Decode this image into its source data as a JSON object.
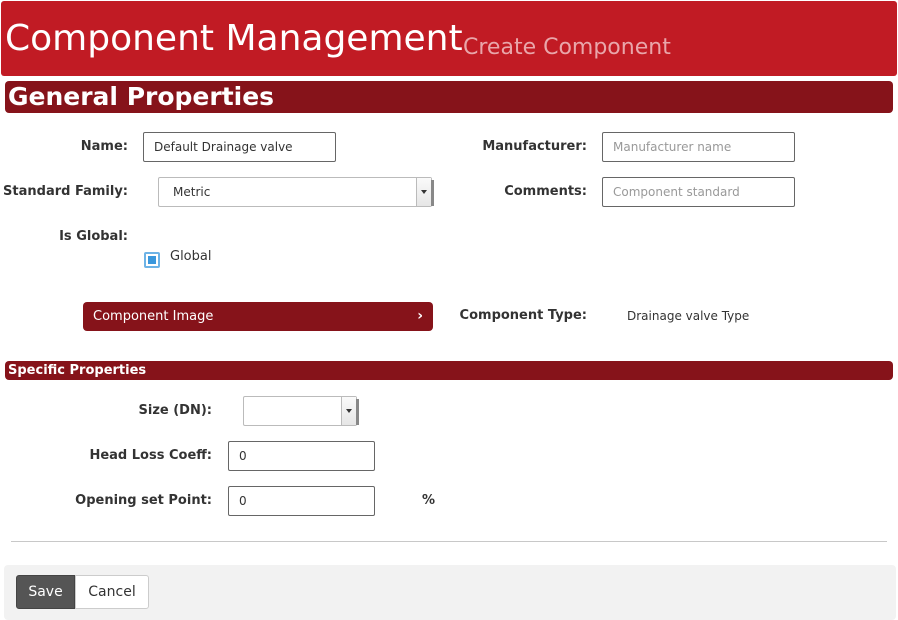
{
  "header": {
    "title": "Component Management",
    "subtitle": "Create Component"
  },
  "general": {
    "section_title": "General Properties",
    "name_label": "Name:",
    "name_value": "Default Drainage valve",
    "manufacturer_label": "Manufacturer:",
    "manufacturer_placeholder": "Manufacturer name",
    "standard_family_label": "Standard Family:",
    "standard_family_value": "Metric",
    "comments_label": "Comments:",
    "comments_placeholder": "Component standard",
    "is_global_label": "Is Global:",
    "global_checkbox_label": "Global",
    "global_checked": true,
    "component_image_button": "Component Image",
    "component_type_label": "Component Type:",
    "component_type_value": "Drainage valve Type"
  },
  "specific": {
    "section_title": "Specific Properties",
    "size_label": "Size (DN):",
    "size_value": "",
    "head_loss_label": "Head Loss Coeff:",
    "head_loss_value": "0",
    "opening_label": "Opening set Point:",
    "opening_value": "0",
    "opening_unit": "%"
  },
  "footer": {
    "save_label": "Save",
    "cancel_label": "Cancel"
  },
  "colors": {
    "header_red": "#c11b24",
    "section_red": "#86131a",
    "checkbox_blue": "#3a97dc"
  },
  "icons": {
    "component_image_chevron": "chevron-right-icon",
    "select_arrow": "caret-down-icon"
  }
}
